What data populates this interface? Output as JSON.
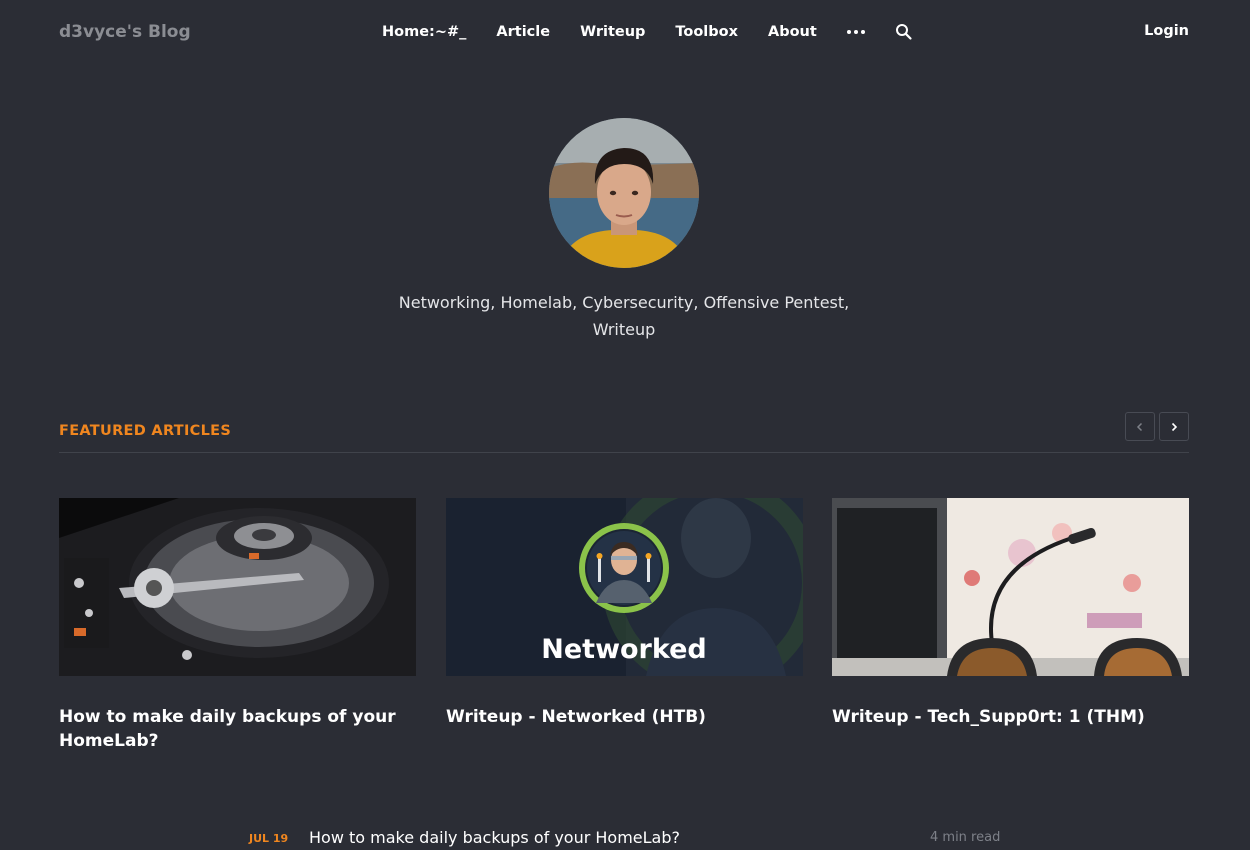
{
  "site": {
    "title": "d3vyce's Blog"
  },
  "nav": {
    "items": [
      "Home:~#_",
      "Article",
      "Writeup",
      "Toolbox",
      "About"
    ],
    "more_icon": "more-dots-icon",
    "search_icon": "search-icon",
    "login": "Login"
  },
  "profile": {
    "bio": "Networking, Homelab, Cybersecurity, Offensive Pentest, Writeup"
  },
  "featured": {
    "heading": "FEATURED ARTICLES",
    "prev_icon": "chevron-left-icon",
    "next_icon": "chevron-right-icon",
    "cards": [
      {
        "title": "How to make daily backups of your HomeLab?"
      },
      {
        "title": "Writeup - Networked (HTB)",
        "image_text": "Networked"
      },
      {
        "title": "Writeup - Tech_Supp0rt: 1 (THM)"
      }
    ]
  },
  "posts": [
    {
      "date": "JUL 19",
      "title": "How to make daily backups of your HomeLab?",
      "read_time": "4 min read"
    }
  ],
  "colors": {
    "background": "#2b2d35",
    "accent": "#f0861f",
    "text": "#ffffff",
    "muted": "#8b8d93"
  }
}
